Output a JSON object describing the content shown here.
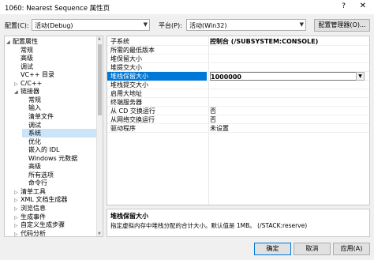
{
  "window": {
    "title": "1060: Nearest Sequence 属性页",
    "help": "?",
    "close": "✕"
  },
  "config": {
    "label": "配置(C):",
    "value": "活动(Debug)"
  },
  "platform": {
    "label": "平台(P):",
    "value": "活动(Win32)"
  },
  "config_manager_button": "配置管理器(O)...",
  "tree": [
    {
      "label": "配置属性",
      "indent": 0,
      "expander": "◢",
      "selected": false
    },
    {
      "label": "常规",
      "indent": 1,
      "expander": "",
      "selected": false
    },
    {
      "label": "高级",
      "indent": 1,
      "expander": "",
      "selected": false
    },
    {
      "label": "调试",
      "indent": 1,
      "expander": "",
      "selected": false
    },
    {
      "label": "VC++ 目录",
      "indent": 1,
      "expander": "",
      "selected": false
    },
    {
      "label": "C/C++",
      "indent": 1,
      "expander": "▷",
      "selected": false
    },
    {
      "label": "链接器",
      "indent": 1,
      "expander": "◢",
      "selected": false
    },
    {
      "label": "常规",
      "indent": 2,
      "expander": "",
      "selected": false
    },
    {
      "label": "输入",
      "indent": 2,
      "expander": "",
      "selected": false
    },
    {
      "label": "清单文件",
      "indent": 2,
      "expander": "",
      "selected": false
    },
    {
      "label": "调试",
      "indent": 2,
      "expander": "",
      "selected": false
    },
    {
      "label": "系统",
      "indent": 2,
      "expander": "",
      "selected": true
    },
    {
      "label": "优化",
      "indent": 2,
      "expander": "",
      "selected": false
    },
    {
      "label": "嵌入的 IDL",
      "indent": 2,
      "expander": "",
      "selected": false
    },
    {
      "label": "Windows 元数据",
      "indent": 2,
      "expander": "",
      "selected": false
    },
    {
      "label": "高级",
      "indent": 2,
      "expander": "",
      "selected": false
    },
    {
      "label": "所有选项",
      "indent": 2,
      "expander": "",
      "selected": false
    },
    {
      "label": "命令行",
      "indent": 2,
      "expander": "",
      "selected": false
    },
    {
      "label": "清单工具",
      "indent": 1,
      "expander": "▷",
      "selected": false
    },
    {
      "label": "XML 文档生成器",
      "indent": 1,
      "expander": "▷",
      "selected": false
    },
    {
      "label": "浏览信息",
      "indent": 1,
      "expander": "▷",
      "selected": false
    },
    {
      "label": "生成事件",
      "indent": 1,
      "expander": "▷",
      "selected": false
    },
    {
      "label": "自定义生成步骤",
      "indent": 1,
      "expander": "▷",
      "selected": false
    },
    {
      "label": "代码分析",
      "indent": 1,
      "expander": "▷",
      "selected": false
    }
  ],
  "properties": [
    {
      "name": "子系统",
      "value": "控制台 (/SUBSYSTEM:CONSOLE)",
      "bold": true,
      "selected": false
    },
    {
      "name": "所需的最低版本",
      "value": "",
      "bold": false,
      "selected": false
    },
    {
      "name": "堆保留大小",
      "value": "",
      "bold": false,
      "selected": false
    },
    {
      "name": "堆提交大小",
      "value": "",
      "bold": false,
      "selected": false
    },
    {
      "name": "堆栈保留大小",
      "value": "1000000",
      "bold": true,
      "selected": true
    },
    {
      "name": "堆栈提交大小",
      "value": "",
      "bold": false,
      "selected": false
    },
    {
      "name": "启用大地址",
      "value": "",
      "bold": false,
      "selected": false
    },
    {
      "name": "终端服务器",
      "value": "",
      "bold": false,
      "selected": false
    },
    {
      "name": "从 CD 交换运行",
      "value": "否",
      "bold": false,
      "selected": false
    },
    {
      "name": "从网络交换运行",
      "value": "否",
      "bold": false,
      "selected": false
    },
    {
      "name": "驱动程序",
      "value": "未设置",
      "bold": false,
      "selected": false
    }
  ],
  "description": {
    "title": "堆栈保留大小",
    "text": "指定虚拟内存中堆栈分配的合计大小。默认值是 1MB。    (/STACK:reserve)"
  },
  "buttons": {
    "ok": "确定",
    "cancel": "取消",
    "apply": "应用(A)"
  },
  "colors": {
    "selection": "#0078d7",
    "tree_selection": "#cce4f7"
  }
}
